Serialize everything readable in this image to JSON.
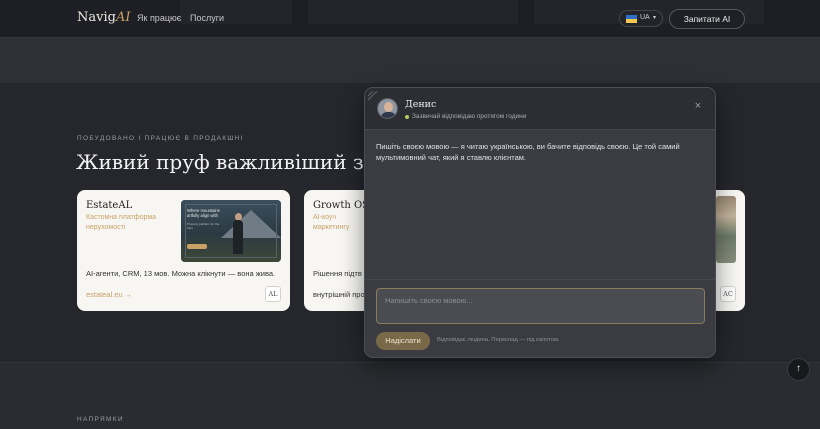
{
  "nav": {
    "logo_main": "Navig",
    "logo_accent": "AI",
    "links": [
      "Як працює",
      "Послуги"
    ],
    "lang_code": "UA",
    "lang_caret": "▾",
    "cta_label": "Запитати AI"
  },
  "section": {
    "eyebrow": "ПОБУДОВАНО І ПРАЦЮЄ В ПРОДАКШНІ",
    "headline": "Живий пруф важливіший за обіцянки"
  },
  "cards": [
    {
      "title": "EstateAL",
      "subtitle": "Кастомна платформа нерухомості",
      "description": "AI-агенти, CRM, 13 мов. Можна клікнути — вона жива.",
      "link": "estateal.eu →",
      "badge": "AL",
      "preview_headline": "Where mountains artfully align with",
      "preview_body": "Property platform for the Alps"
    },
    {
      "title": "Growth OS",
      "subtitle": "AI-коуч маркетингу",
      "description": "Рішення підтв",
      "link": "внутрішній про",
      "badge": ""
    },
    {
      "badge": "AC"
    }
  ],
  "lower": {
    "eyebrow": "НАПРЯМКИ",
    "scroll_top_icon": "↑"
  },
  "chat": {
    "agent_name": "Денис",
    "status": "Зазвичай відповідаю протягом години",
    "close_icon": "×",
    "message": "Пишіть своєю мовою — я читаю українською, ви бачите відповідь своєю. Це той самий мультимовний чат, який я ставлю клієнтам.",
    "input_placeholder": "Напишіть своєю мовою...",
    "send_label": "Надіслати",
    "footnote": "Відповідає людина. Переклад — під капотом."
  },
  "colors": {
    "accent": "#c9a165",
    "page_bg": "#25272d",
    "panel_bg": "#3a3c42",
    "status_online": "#b7c95a"
  }
}
